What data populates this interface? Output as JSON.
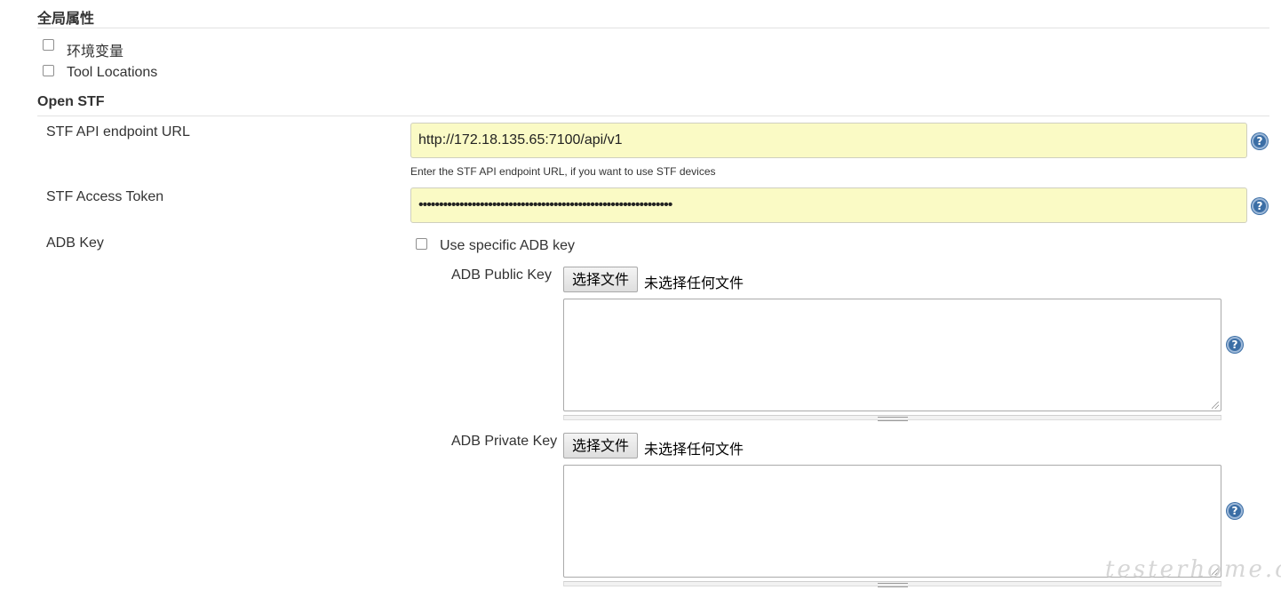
{
  "global_props": {
    "title": "全局属性",
    "options": [
      {
        "label": "环境变量",
        "checked": false
      },
      {
        "label": "Tool Locations",
        "checked": false
      }
    ]
  },
  "open_stf": {
    "title": "Open STF",
    "endpoint": {
      "label": "STF API endpoint URL",
      "value": "http://172.18.135.65:7100/api/v1",
      "hint": "Enter the STF API endpoint URL, if you want to use STF devices"
    },
    "token": {
      "label": "STF Access Token",
      "masked_value": "••••••••••••••••••••••••••••••••••••••••••••••••••••••••••••••"
    },
    "adb_key": {
      "label": "ADB Key",
      "use_specific_label": "Use specific ADB key",
      "use_specific_checked": false,
      "public_key": {
        "label": "ADB Public Key",
        "button": "选择文件",
        "status": "未选择任何文件",
        "value": ""
      },
      "private_key": {
        "label": "ADB Private Key",
        "button": "选择文件",
        "status": "未选择任何文件",
        "value": ""
      }
    }
  },
  "help_icon_glyph": "?",
  "watermark": "testerhome.com",
  "colors": {
    "input_bg": "#fafac5",
    "help_icon": "#3b6ea5",
    "divider": "#e2e2e2"
  }
}
